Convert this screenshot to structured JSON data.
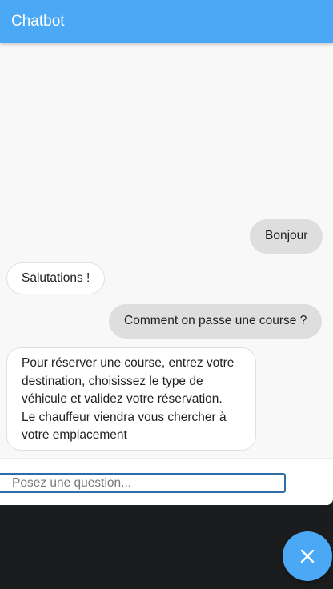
{
  "header": {
    "title": "Chatbot"
  },
  "messages": [
    {
      "sender": "user",
      "text": "Bonjour"
    },
    {
      "sender": "bot",
      "text": "Salutations !"
    },
    {
      "sender": "user",
      "text": "Comment on passe une course ?"
    },
    {
      "sender": "bot",
      "lines": [
        "Pour réserver une course, entrez votre",
        "destination, choisissez le type de",
        "véhicule et validez votre réservation.",
        "Le chauffeur viendra vous chercher à",
        "votre emplacement"
      ]
    }
  ],
  "input": {
    "placeholder": "Posez une question...",
    "value": ""
  },
  "fab": {
    "icon": "close-icon"
  },
  "colors": {
    "accent": "#4aa8f4",
    "bot_bubble": "#ffffff",
    "user_bubble": "#dedede",
    "background": "#f8f8f8"
  }
}
